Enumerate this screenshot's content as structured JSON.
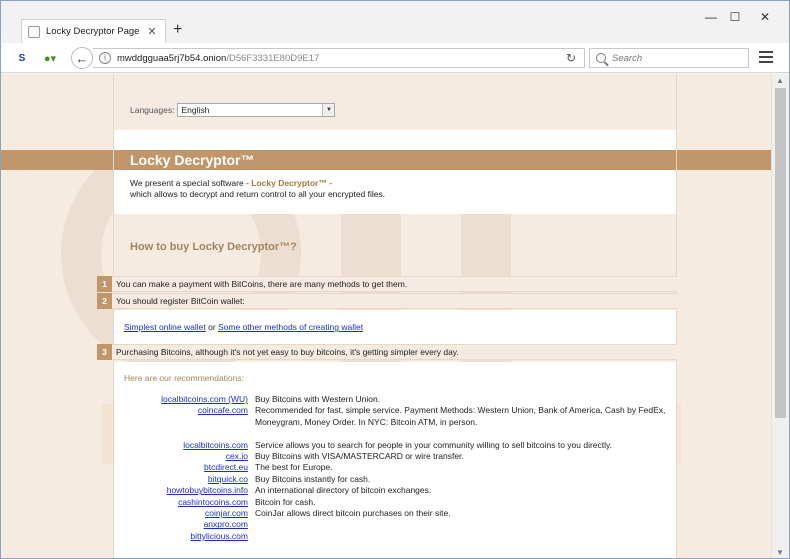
{
  "browser": {
    "tab_title": "Locky Decryptor Page",
    "url_host": "mwddgguaa5rj7b54.onion",
    "url_path": "/D56F3331E80D9E17",
    "search_placeholder": "Search",
    "s_logo": "S"
  },
  "page": {
    "languages_label": "Languages:",
    "language_selected": "English",
    "title": "Locky Decryptor™",
    "intro_line1_pre": "We present a special software - ",
    "intro_line1_brand": "Locky Decryptor™",
    "intro_line1_post": " -",
    "intro_line2": "which allows to decrypt and return control to all your encrypted files.",
    "howto_title": "How to buy Locky Decryptor™?",
    "steps": [
      {
        "num": "1",
        "text": "You can make a payment with BitCoins, there are many methods to get them."
      },
      {
        "num": "2",
        "text": "You should register BitCoin wallet:"
      },
      {
        "num": "3",
        "text": "Purchasing Bitcoins, although it's not yet easy to buy bitcoins, it's getting simpler every day."
      }
    ],
    "wallet_link1": "Simplest online wallet",
    "wallet_or": " or ",
    "wallet_link2": "Some other methods of creating wallet",
    "rec_title": "Here are our recommendations:",
    "recommendations": [
      {
        "link": "localbitcoins.com (WU)",
        "desc": "Buy Bitcoins with Western Union."
      },
      {
        "link": "coincafe.com",
        "desc": "Recommended for fast, simple service. Payment Methods: Western Union, Bank of America, Cash by FedEx, Moneygram, Money Order. In NYC: Bitcoin ATM, in person."
      },
      {
        "link": "localbitcoins.com",
        "desc": "Service allows you to search for people in your community willing to sell bitcoins to you directly."
      },
      {
        "link": "cex.io",
        "desc": "Buy Bitcoins with VISA/MASTERCARD or wire transfer."
      },
      {
        "link": "btcdirect.eu",
        "desc": "The best for Europe."
      },
      {
        "link": "bitquick.co",
        "desc": "Buy Bitcoins instantly for cash."
      },
      {
        "link": "howtobuybitcoins.info",
        "desc": "An international directory of bitcoin exchanges."
      },
      {
        "link": "cashintocoins.com",
        "desc": "Bitcoin for cash."
      },
      {
        "link": "coinjar.com",
        "desc": "CoinJar allows direct bitcoin purchases on their site."
      },
      {
        "link": "anxpro.com",
        "desc": ""
      },
      {
        "link": "bittylicious.com",
        "desc": ""
      }
    ]
  },
  "colors": {
    "accent_brown": "#c0966a",
    "page_bg": "#f5ebe0",
    "link_blue": "#1a2fc8"
  }
}
